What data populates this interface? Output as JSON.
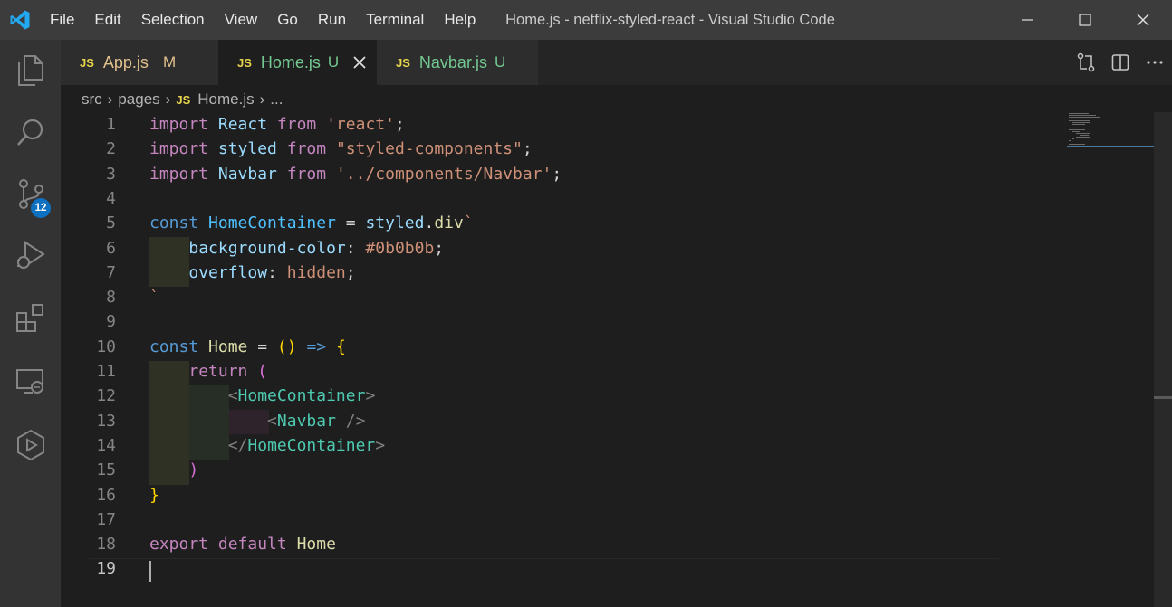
{
  "titlebar": {
    "menu": [
      "File",
      "Edit",
      "Selection",
      "View",
      "Go",
      "Run",
      "Terminal",
      "Help"
    ],
    "title": "Home.js - netflix-styled-react - Visual Studio Code"
  },
  "activity_bar": {
    "items": [
      "files-icon",
      "search-icon",
      "source-control-icon",
      "run-debug-icon",
      "extensions-icon",
      "remote-explorer-icon",
      "deploy-icon"
    ],
    "source_control_badge": "12"
  },
  "tabs": [
    {
      "label": "App.js",
      "badge": "JS",
      "flag": "M"
    },
    {
      "label": "Home.js",
      "badge": "JS",
      "flag": "U"
    },
    {
      "label": "Navbar.js",
      "badge": "JS",
      "flag": "U"
    }
  ],
  "breadcrumb": {
    "items": [
      "src",
      "pages",
      "Home.js",
      "..."
    ],
    "file_badge": "JS"
  },
  "editor": {
    "line_numbers": [
      "1",
      "2",
      "3",
      "4",
      "5",
      "6",
      "7",
      "8",
      "9",
      "10",
      "11",
      "12",
      "13",
      "14",
      "15",
      "16",
      "17",
      "18",
      "19"
    ],
    "current_line": "19"
  },
  "colors": {
    "keyword": "#c586c0",
    "storage": "#569cd6",
    "string": "#ce9178",
    "tag": "#4ec9b0",
    "accent_badge": "#0e70c0"
  }
}
